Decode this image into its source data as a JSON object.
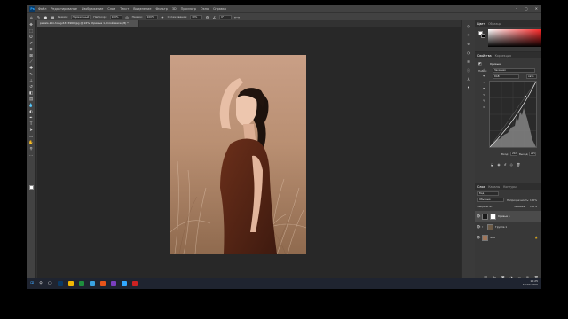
{
  "menu": {
    "logo": "Ps",
    "items": [
      "Файл",
      "Редактирование",
      "Изображение",
      "Слои",
      "Текст",
      "Выделение",
      "Фильтр",
      "3D",
      "Просмотр",
      "Окно",
      "Справка"
    ],
    "window_controls": [
      "–",
      "▢",
      "✕"
    ]
  },
  "options_bar": {
    "mode_label": "Режим:",
    "mode_value": "Нормальный",
    "opacity_label": "Непрозр.:",
    "opacity_value": "100%",
    "flow_label": "Нажим:",
    "flow_value": "100%",
    "smoothing_label": "Сглаживание:",
    "smoothing_value": "10%",
    "angle_value": "0°"
  },
  "document": {
    "tab_title": "pexels-kiki-hong-6313960.jpg @ 16% (Кривые 1, Слой-маска/8) *",
    "status": "16,67%   3840 пикс. x 5760 пикс. (72 ppi)"
  },
  "panels": {
    "color_tabs": [
      "Цвет",
      "Образцы"
    ],
    "props_tabs": [
      "Свойства",
      "Коррекция"
    ],
    "props_title": "Кривые",
    "preset_label": "Набор:",
    "preset_value": "Заказная",
    "channel_value": "RGB",
    "auto_label": "Авто",
    "input_label": "Вход:",
    "input_value": "202",
    "output_label": "Выход:",
    "output_value": "215",
    "layers_tabs": [
      "Слои",
      "Каналы",
      "Контуры"
    ],
    "kind_label": "Вид",
    "blend_value": "Обычные",
    "opacity_label": "Непрозрачность:",
    "opacity_value": "100%",
    "lock_label": "Закрепить:",
    "fill_label": "Заливка:",
    "fill_value": "100%",
    "layers": [
      {
        "name": "Кривые 1",
        "selected": true
      },
      {
        "name": "Группа 1",
        "selected": false
      },
      {
        "name": "Фон",
        "selected": false
      }
    ]
  },
  "taskbar": {
    "time": "15:25",
    "date": "20.03.2022"
  },
  "colors": {
    "app_bg": "#323232",
    "panel_bg": "#383838",
    "canvas_bg": "#282828",
    "accent_blue": "#31a8ff",
    "taskbar_bg": "#1f2430"
  }
}
